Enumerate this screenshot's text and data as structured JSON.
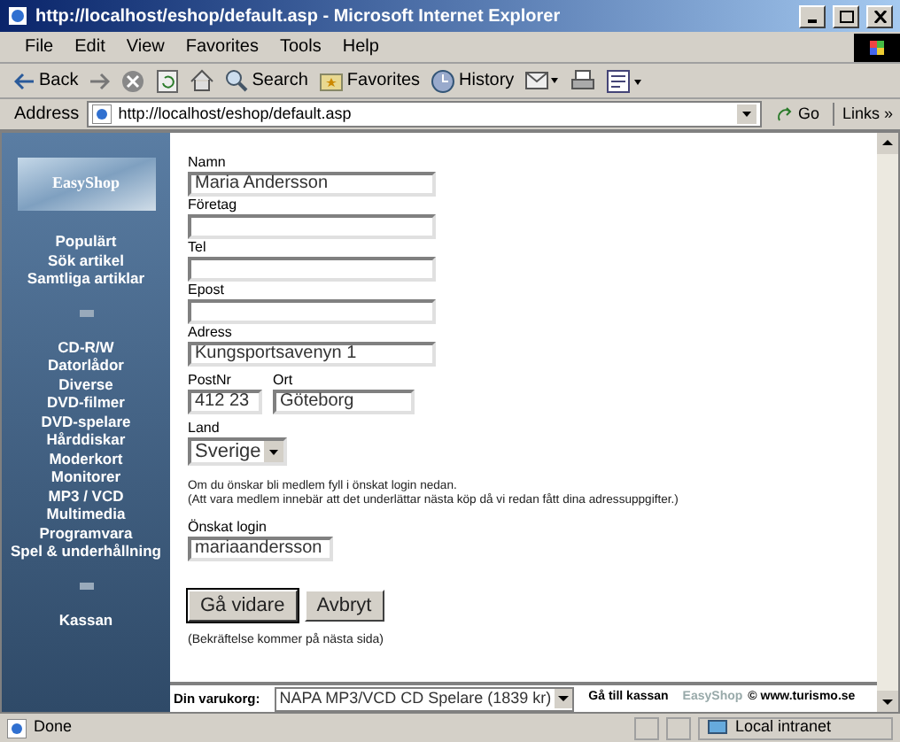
{
  "window": {
    "title": "http://localhost/eshop/default.asp - Microsoft Internet Explorer"
  },
  "menu": [
    "File",
    "Edit",
    "View",
    "Favorites",
    "Tools",
    "Help"
  ],
  "toolbar": [
    {
      "kind": "back",
      "label": "Back"
    },
    {
      "kind": "forward"
    },
    {
      "kind": "stop"
    },
    {
      "kind": "refresh"
    },
    {
      "kind": "home"
    },
    {
      "kind": "search",
      "label": "Search"
    },
    {
      "kind": "favorites",
      "label": "Favorites"
    },
    {
      "kind": "history",
      "label": "History"
    },
    {
      "kind": "mail"
    },
    {
      "kind": "print"
    },
    {
      "kind": "edit"
    }
  ],
  "address": {
    "label": "Address",
    "url": "http://localhost/eshop/default.asp",
    "go": "Go",
    "links": "Links »"
  },
  "sidebar": {
    "logo": "EasyShop",
    "groups": [
      [
        "Populärt",
        "Sök artikel",
        "Samtliga artiklar"
      ],
      [
        "CD-R/W",
        "Datorlådor",
        "Diverse",
        "DVD-filmer",
        "DVD-spelare",
        "Hårddiskar",
        "Moderkort",
        "Monitorer",
        "MP3 / VCD",
        "Multimedia",
        "Programvara",
        "Spel & underhållning"
      ],
      [
        "Kassan"
      ]
    ]
  },
  "form": {
    "fields": [
      {
        "label": "Namn",
        "value": "Maria Andersson"
      },
      {
        "label": "Företag"
      },
      {
        "label": "Tel"
      },
      {
        "label": "Epost"
      },
      {
        "label": "Adress",
        "value": "Kungsportsavenyn 1"
      }
    ],
    "postnr": {
      "label": "PostNr",
      "value": "412 23"
    },
    "ort": {
      "label": "Ort",
      "value": "Göteborg"
    },
    "land": {
      "label": "Land",
      "value": "Sverige"
    },
    "info": [
      "Om du önskar bli medlem fyll i önskat login nedan.",
      "(Att vara medlem innebär att det underlättar nästa köp då vi redan fått dina adressuppgifter.)"
    ],
    "login": {
      "label": "Önskat login",
      "value": "mariaandersson"
    },
    "buttons": [
      "Gå vidare",
      "Avbryt"
    ],
    "note": "(Bekräftelse kommer på nästa sida)"
  },
  "cart": {
    "label": "Din varukorg:",
    "value": "NAPA MP3/VCD CD Spelare (1839 kr)",
    "checkout": "Gå till kassan",
    "brand": "EasyShop",
    "copyright": "© www.turismo.se"
  },
  "status": {
    "text": "Done",
    "zone": "Local intranet"
  }
}
